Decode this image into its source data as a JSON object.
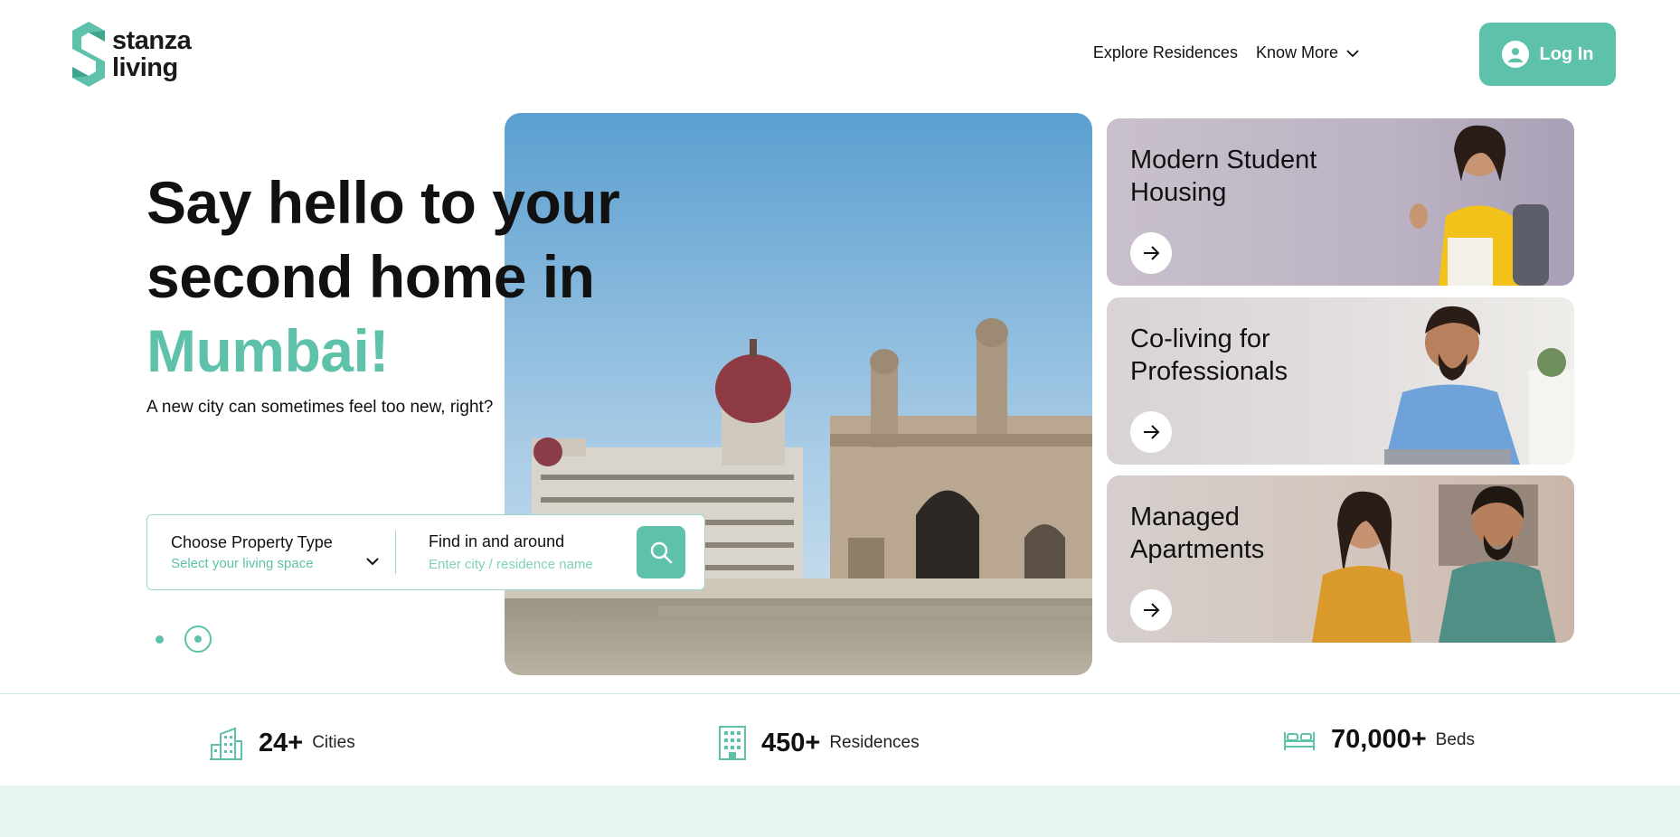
{
  "brand": {
    "line1": "stanza",
    "line2": "living",
    "accent": "#5ec2ab"
  },
  "nav": {
    "explore": "Explore Residences",
    "know_more": "Know More",
    "login": "Log In"
  },
  "hero": {
    "title_line1": "Say hello to your",
    "title_line2": "second home in",
    "city": "Mumbai!",
    "subtitle": "A new city can sometimes feel too new, right?",
    "image": "gateway-of-india-photo"
  },
  "search": {
    "property_label": "Choose Property Type",
    "property_hint": "Select your living space",
    "find_label": "Find in and around",
    "find_placeholder": "Enter city / residence name",
    "search_icon": "search-icon"
  },
  "carousel": {
    "total": 2,
    "active": 2
  },
  "cards": [
    {
      "title_line1": "Modern Student",
      "title_line2": "Housing",
      "arrow": "arrow-right-icon"
    },
    {
      "title_line1": "Co-living for",
      "title_line2": "Professionals",
      "arrow": "arrow-right-icon"
    },
    {
      "title_line1": "Managed",
      "title_line2": "Apartments",
      "arrow": "arrow-right-icon"
    }
  ],
  "stats": [
    {
      "icon": "city-buildings-icon",
      "number": "24+",
      "label": "Cities"
    },
    {
      "icon": "building-icon",
      "number": "450+",
      "label": "Residences"
    },
    {
      "icon": "bed-icon",
      "number": "70,000+",
      "label": "Beds"
    }
  ]
}
